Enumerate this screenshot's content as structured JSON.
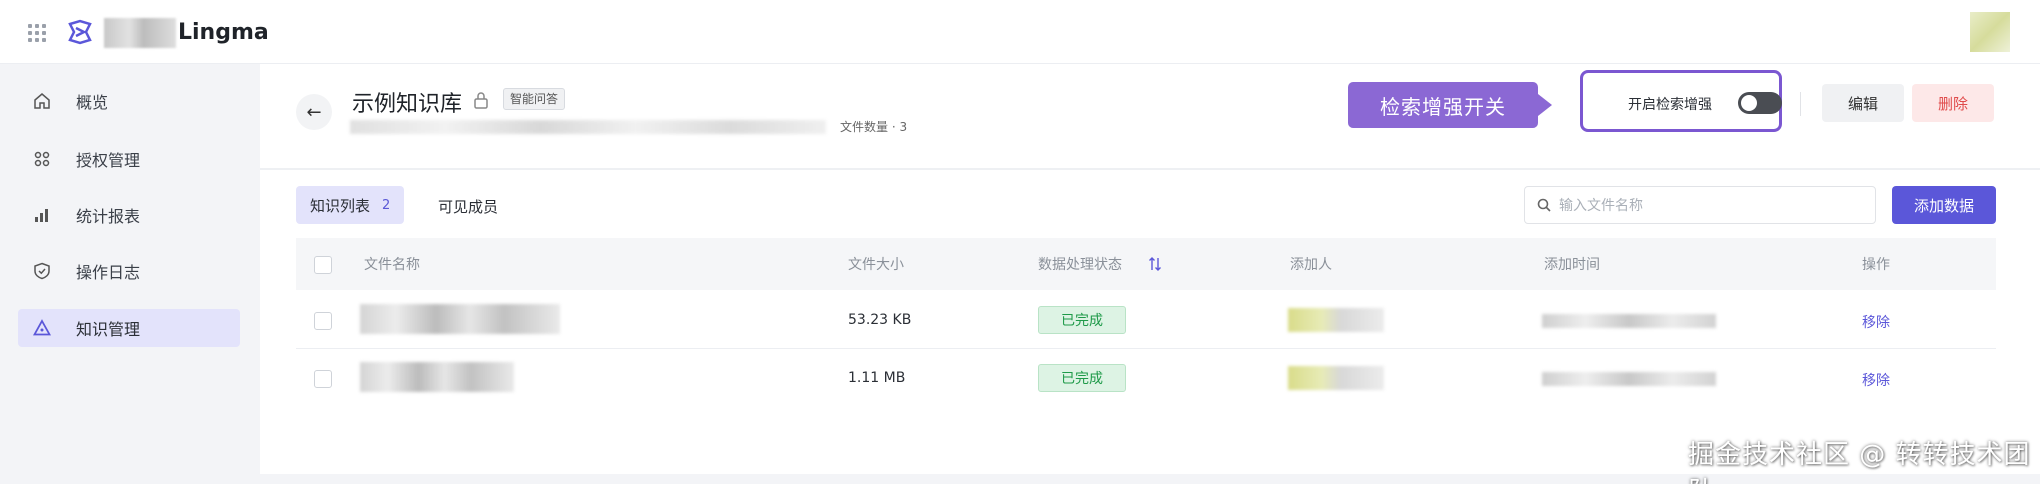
{
  "header": {
    "app_name": "Lingma"
  },
  "sidebar": {
    "items": [
      {
        "label": "概览",
        "icon": "home-icon",
        "active": false
      },
      {
        "label": "授权管理",
        "icon": "apps-icon",
        "active": false
      },
      {
        "label": "统计报表",
        "icon": "bar-chart-icon",
        "active": false
      },
      {
        "label": "操作日志",
        "icon": "shield-icon",
        "active": false
      },
      {
        "label": "知识管理",
        "icon": "triangle-icon",
        "active": true
      }
    ]
  },
  "kb": {
    "title": "示例知识库",
    "tag": "智能问答",
    "file_count": "文件数量 · 3",
    "callout": "检索增强开关",
    "toggle_label": "开启检索增强",
    "toggle_on": false,
    "edit_label": "编辑",
    "delete_label": "删除"
  },
  "tabs": {
    "list_label": "知识列表",
    "list_count": "2",
    "members_label": "可见成员"
  },
  "search": {
    "placeholder": "输入文件名称"
  },
  "add_button": "添加数据",
  "table": {
    "columns": {
      "name": "文件名称",
      "size": "文件大小",
      "status": "数据处理状态",
      "adder": "添加人",
      "time": "添加时间",
      "action": "操作"
    },
    "rows": [
      {
        "size": "53.23 KB",
        "status": "已完成",
        "action": "移除"
      },
      {
        "size": "1.11 MB",
        "status": "已完成",
        "action": "移除"
      }
    ]
  },
  "watermark": "掘金技术社区 @ 转转技术团队",
  "colors": {
    "accent": "#5b57d9",
    "callout": "#8b68d4",
    "success": "#1e9a49",
    "danger": "#e04a4a"
  }
}
